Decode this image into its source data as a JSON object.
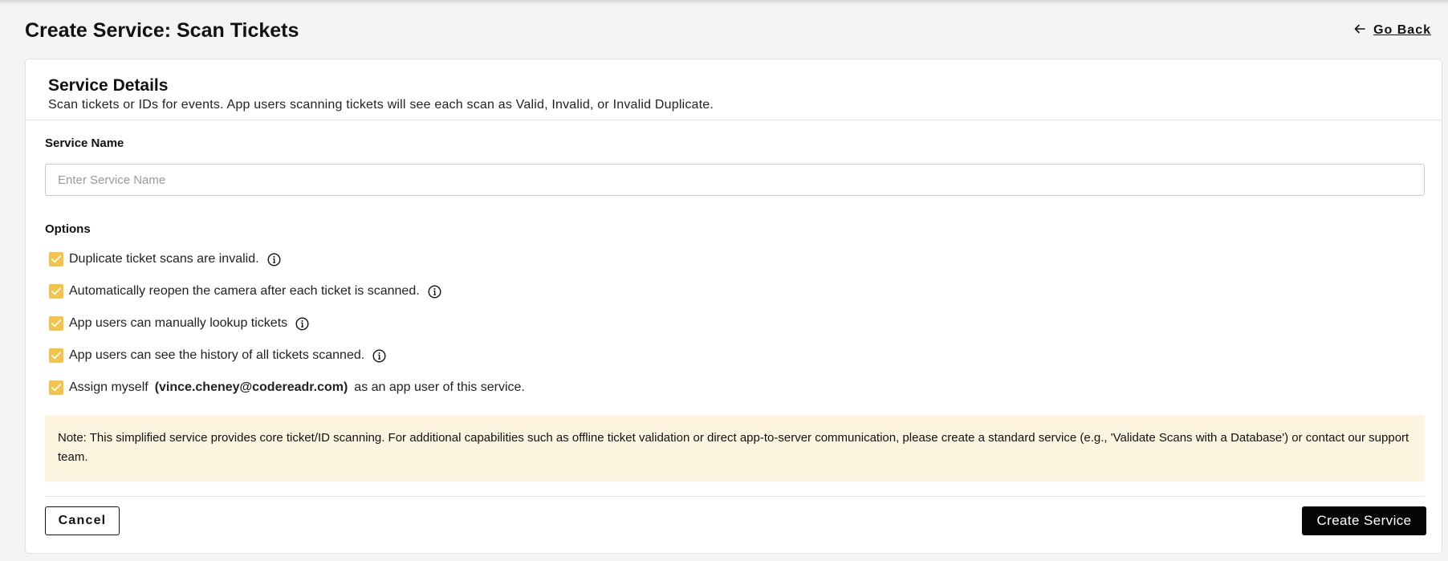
{
  "header": {
    "title": "Create Service: Scan Tickets",
    "go_back_label": "Go Back",
    "go_back_icon": "arrow-left-icon"
  },
  "service_details": {
    "title": "Service Details",
    "description": "Scan tickets or IDs for events. App users scanning tickets will see each scan as Valid, Invalid, or Invalid Duplicate."
  },
  "service_name": {
    "label": "Service Name",
    "value": "",
    "placeholder": "Enter Service Name"
  },
  "options": {
    "label": "Options",
    "items": [
      {
        "label": "Duplicate ticket scans are invalid.",
        "checked": true,
        "info_icon": "info-icon"
      },
      {
        "label": "Automatically reopen the camera after each ticket is scanned.",
        "checked": true,
        "info_icon": "info-icon"
      },
      {
        "label": "App users can manually lookup tickets",
        "checked": true,
        "info_icon": "info-icon"
      },
      {
        "label": "App users can see the history of all tickets scanned.",
        "checked": true,
        "info_icon": "info-icon"
      }
    ],
    "assign": {
      "prefix": "Assign myself",
      "email": "(vince.cheney@codereadr.com)",
      "suffix": "as an app user of this service.",
      "checked": true
    }
  },
  "note": {
    "text": "Note: This simplified service provides core ticket/ID scanning. For additional capabilities such as offline ticket validation or direct app-to-server communication, please create a standard service (e.g., 'Validate Scans with a Database') or contact our support team."
  },
  "footer": {
    "cancel_label": "Cancel",
    "create_label": "Create Service"
  },
  "colors": {
    "checkbox": "#f3c44a",
    "note_background": "#fdf5e0",
    "primary_button": "#050505",
    "page_background": "#f4f4f4"
  }
}
